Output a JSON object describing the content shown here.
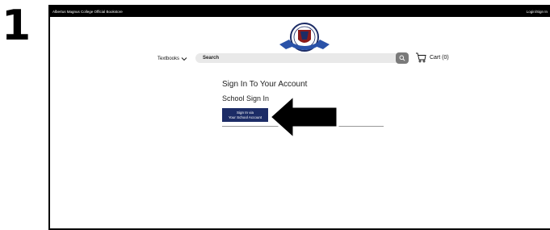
{
  "step_number": "1",
  "topbar": {
    "store_name": "Albertus Magnus College Official Bookstore",
    "login_link": "Login/Sign In"
  },
  "nav": {
    "textbooks_label": "Textbooks"
  },
  "search": {
    "placeholder": "Search"
  },
  "cart": {
    "label": "Cart (0)"
  },
  "signin": {
    "title": "Sign In To Your Account",
    "school_heading": "School Sign In",
    "button_line1": "Sign In via",
    "button_line2": "Your School Account"
  },
  "colors": {
    "topbar": "#000000",
    "button": "#1c2c66",
    "search_bg": "#e9e9e9",
    "search_button": "#7a7a7a"
  },
  "icons": [
    "college-seal-icon",
    "chevron-down-icon",
    "search-icon",
    "cart-icon",
    "arrow-pointer-icon"
  ]
}
